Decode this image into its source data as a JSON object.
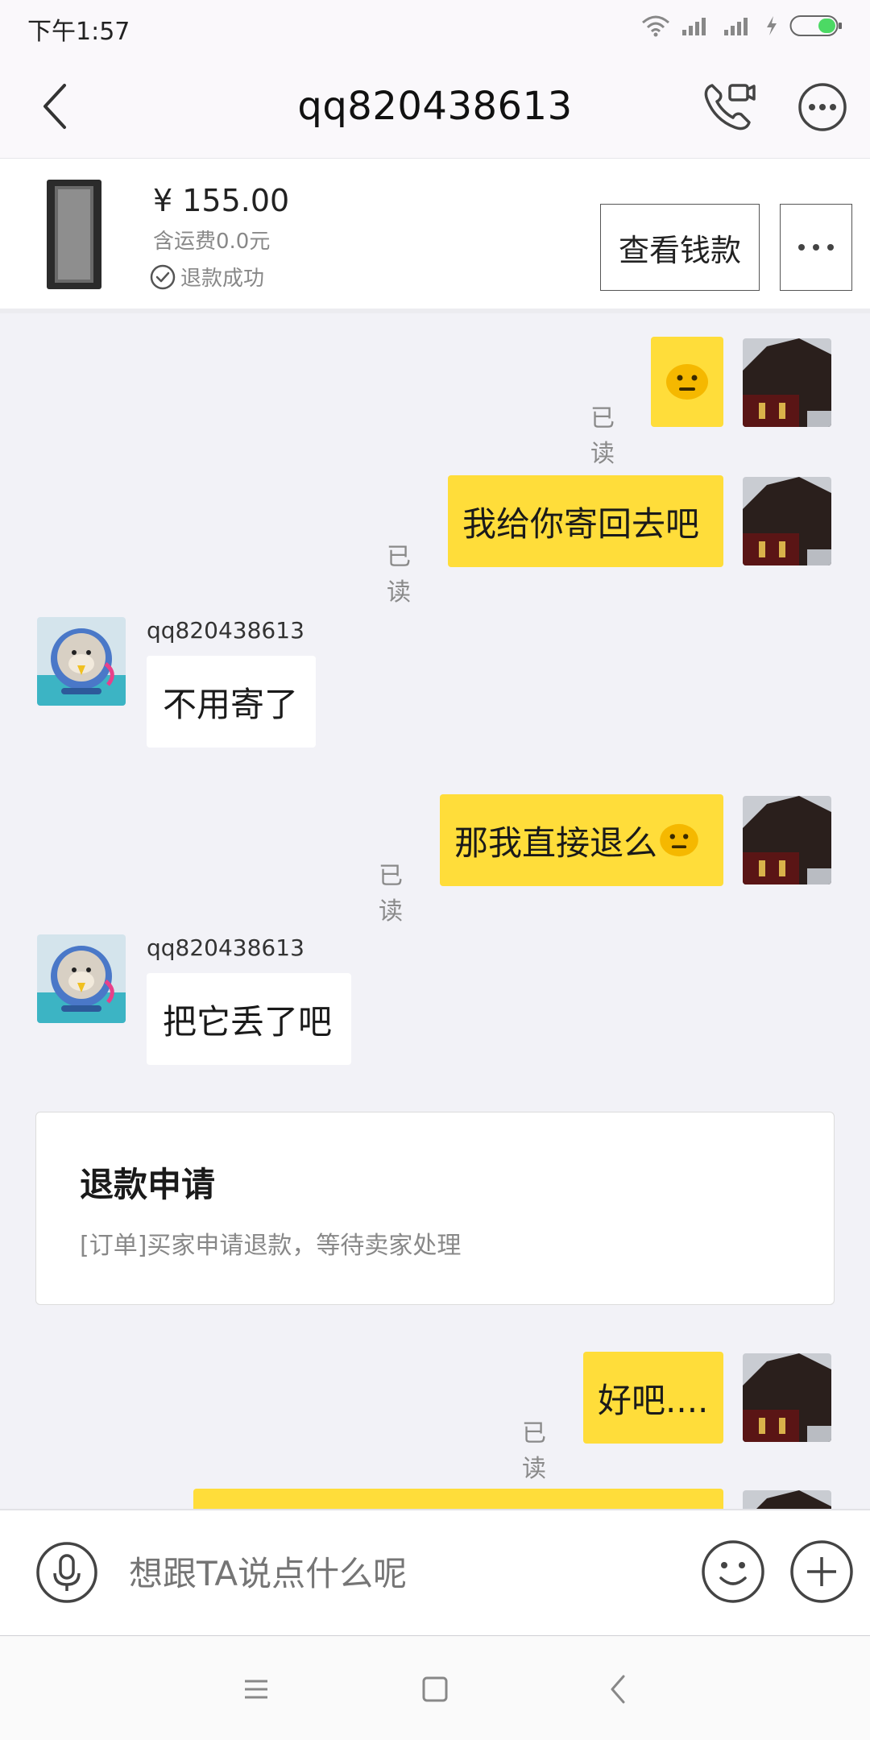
{
  "status_bar": {
    "time": "下午1:57"
  },
  "header": {
    "title": "qq820438613"
  },
  "order": {
    "price": "¥ 155.00",
    "shipping": "含运费0.0元",
    "status": "退款成功",
    "view_money_label": "查看钱款"
  },
  "chat": {
    "read_label": "已读",
    "messages": [
      {
        "from": "me",
        "text": ""
      },
      {
        "from": "me",
        "text": "我给你寄回去吧"
      },
      {
        "from": "them",
        "sender": "qq820438613",
        "text": "不用寄了"
      },
      {
        "from": "me",
        "text": "那我直接退么"
      },
      {
        "from": "them",
        "sender": "qq820438613",
        "text": "把它丢了吧"
      },
      {
        "from": "me",
        "text": "好吧...."
      }
    ],
    "refund_card": {
      "title": "退款申请",
      "description": "[订单]买家申请退款，等待卖家处理"
    }
  },
  "input": {
    "placeholder": "想跟TA说点什么呢"
  },
  "icons": {
    "back": "back-arrow-icon",
    "call": "phone-video-icon",
    "more": "more-dots-icon",
    "mic": "microphone-icon",
    "emoji": "smiley-icon",
    "plus": "plus-icon",
    "sys_menu": "menu-icon",
    "sys_home": "home-square-icon",
    "sys_back": "back-chevron-icon"
  },
  "colors": {
    "bubble_me": "#ffdd3a",
    "bubble_them": "#ffffff",
    "background": "#f2f2f7"
  }
}
